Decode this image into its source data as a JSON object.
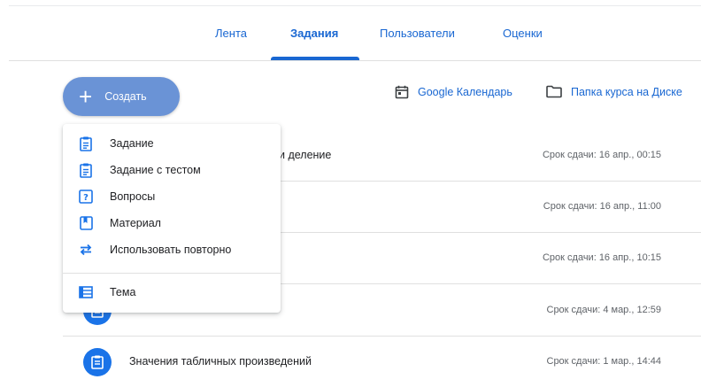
{
  "tabs": [
    {
      "label": "Лента"
    },
    {
      "label": "Задания"
    },
    {
      "label": "Пользователи"
    },
    {
      "label": "Оценки"
    }
  ],
  "toolbar": {
    "create_label": "Создать",
    "calendar_label": "Google Календарь",
    "drive_label": "Папка курса на Диске"
  },
  "create_menu": {
    "items": [
      {
        "label": "Задание",
        "icon": "assignment-icon"
      },
      {
        "label": "Задание с тестом",
        "icon": "quiz-assignment-icon"
      },
      {
        "label": "Вопросы",
        "icon": "question-icon"
      },
      {
        "label": "Материал",
        "icon": "material-icon"
      },
      {
        "label": "Использовать повторно",
        "icon": "reuse-icon"
      }
    ],
    "topic": {
      "label": "Тема",
      "icon": "topic-icon"
    }
  },
  "assignments": [
    {
      "title": "и деление",
      "due": "Срок сдачи: 16 апр., 00:15"
    },
    {
      "title": "",
      "due": "Срок сдачи: 16 апр., 11:00"
    },
    {
      "title": "",
      "due": "Срок сдачи: 16 апр., 10:15"
    },
    {
      "title": "",
      "due": "Срок сдачи: 4 мар., 12:59"
    },
    {
      "title": "Значения табличных произведений",
      "due": "Срок сдачи: 1 мар., 14:44"
    }
  ],
  "colors": {
    "accent": "#1967d2",
    "create_button": "#6a93d6",
    "assignment_icon_bg": "#1a73e8"
  }
}
